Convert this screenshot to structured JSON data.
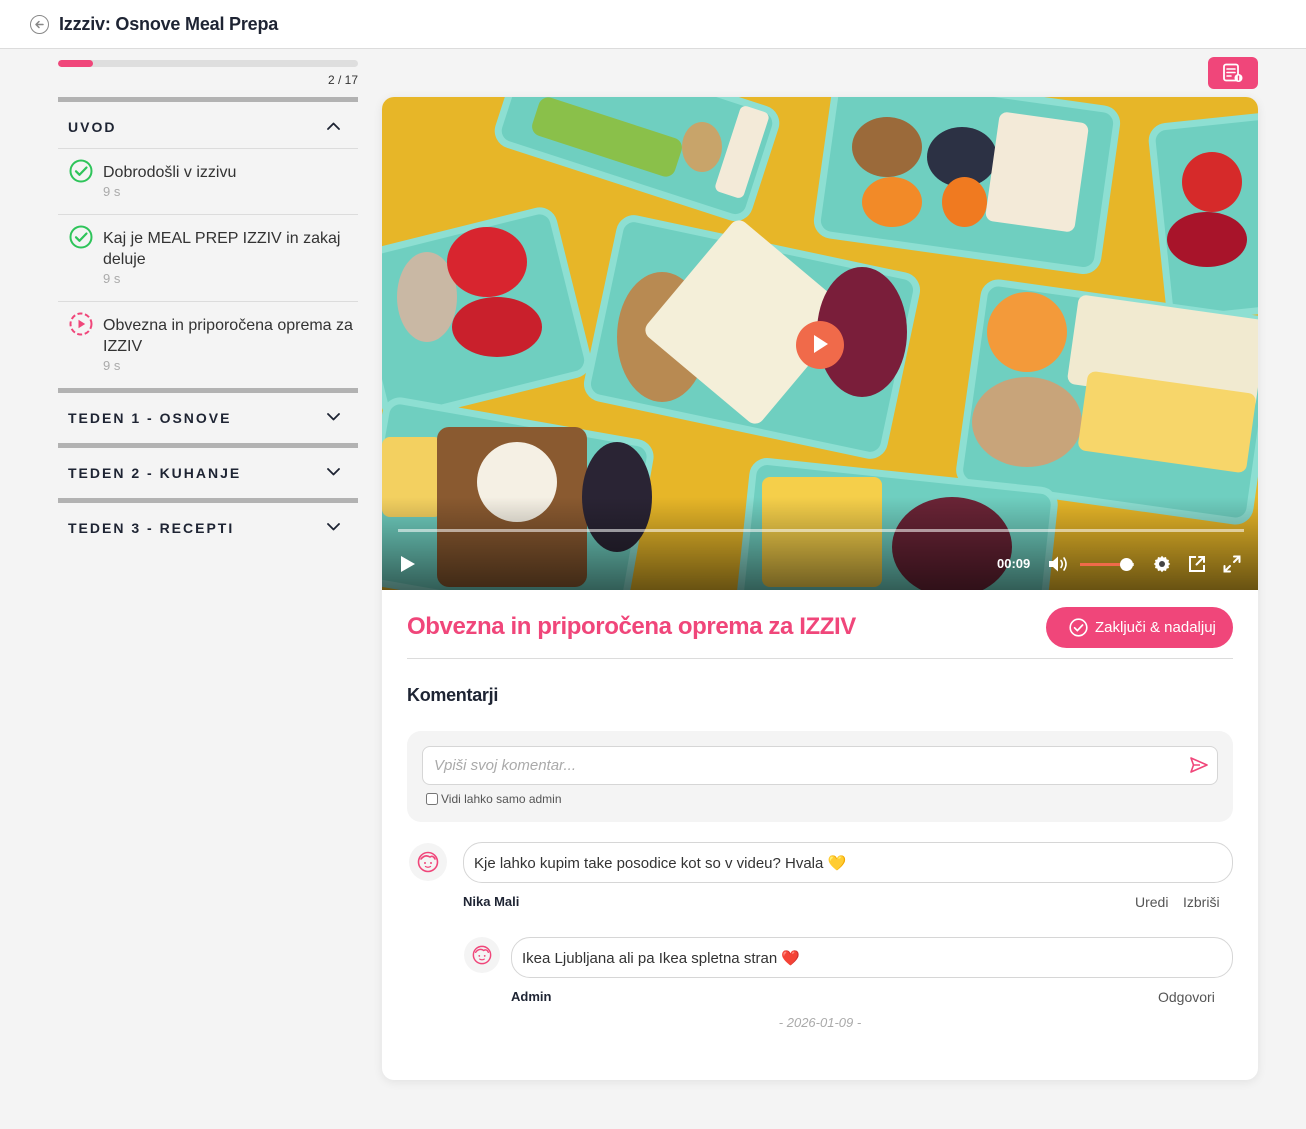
{
  "header": {
    "title": "Izzziv: Osnove Meal Prepa"
  },
  "progress": {
    "fraction": 0.117,
    "count_text": "2 / 17"
  },
  "sidebar": {
    "sections": [
      {
        "title": "UVOD",
        "state": "expanded"
      },
      {
        "title": "TEDEN 1 - OSNOVE",
        "state": "collapsed"
      },
      {
        "title": "TEDEN 2 - KUHANJE",
        "state": "collapsed"
      },
      {
        "title": "TEDEN 3 - RECEPTI",
        "state": "collapsed"
      }
    ],
    "lessons": [
      {
        "title": "Dobrodošli v izzivu",
        "duration": "9 s",
        "status": "completed"
      },
      {
        "title": "Kaj je MEAL PREP IZZIV in zakaj deluje",
        "duration": "9 s",
        "status": "completed"
      },
      {
        "title": "Obvezna in priporočena oprema za IZZIV",
        "duration": "9 s",
        "status": "in-progress"
      }
    ]
  },
  "video": {
    "time": "00:09",
    "volume": 0.85,
    "played": 0.0
  },
  "lesson": {
    "title": "Obvezna in priporočena oprema za IZZIV",
    "complete_label": "Zaključi & nadaljuj"
  },
  "comments": {
    "heading": "Komentarji",
    "input_placeholder": "Vpiši svoj komentar...",
    "admin_only_label": "Vidi lahko samo admin",
    "items": [
      {
        "author": "Nika Mali",
        "text": "Kje lahko kupim take posodice kot so v videu? Hvala",
        "emoji": "💛",
        "actions": [
          "Uredi",
          "Izbriši"
        ]
      },
      {
        "author": "Admin",
        "text": "Ikea Ljubljana ali pa Ikea spletna stran",
        "emoji": "❤️",
        "actions": [
          "Odgovori"
        ]
      }
    ],
    "date": "- 2026-01-09 -"
  },
  "colors": {
    "accent": "#f0467a",
    "success": "#2ec45a",
    "video_accent": "#f06a4a"
  }
}
